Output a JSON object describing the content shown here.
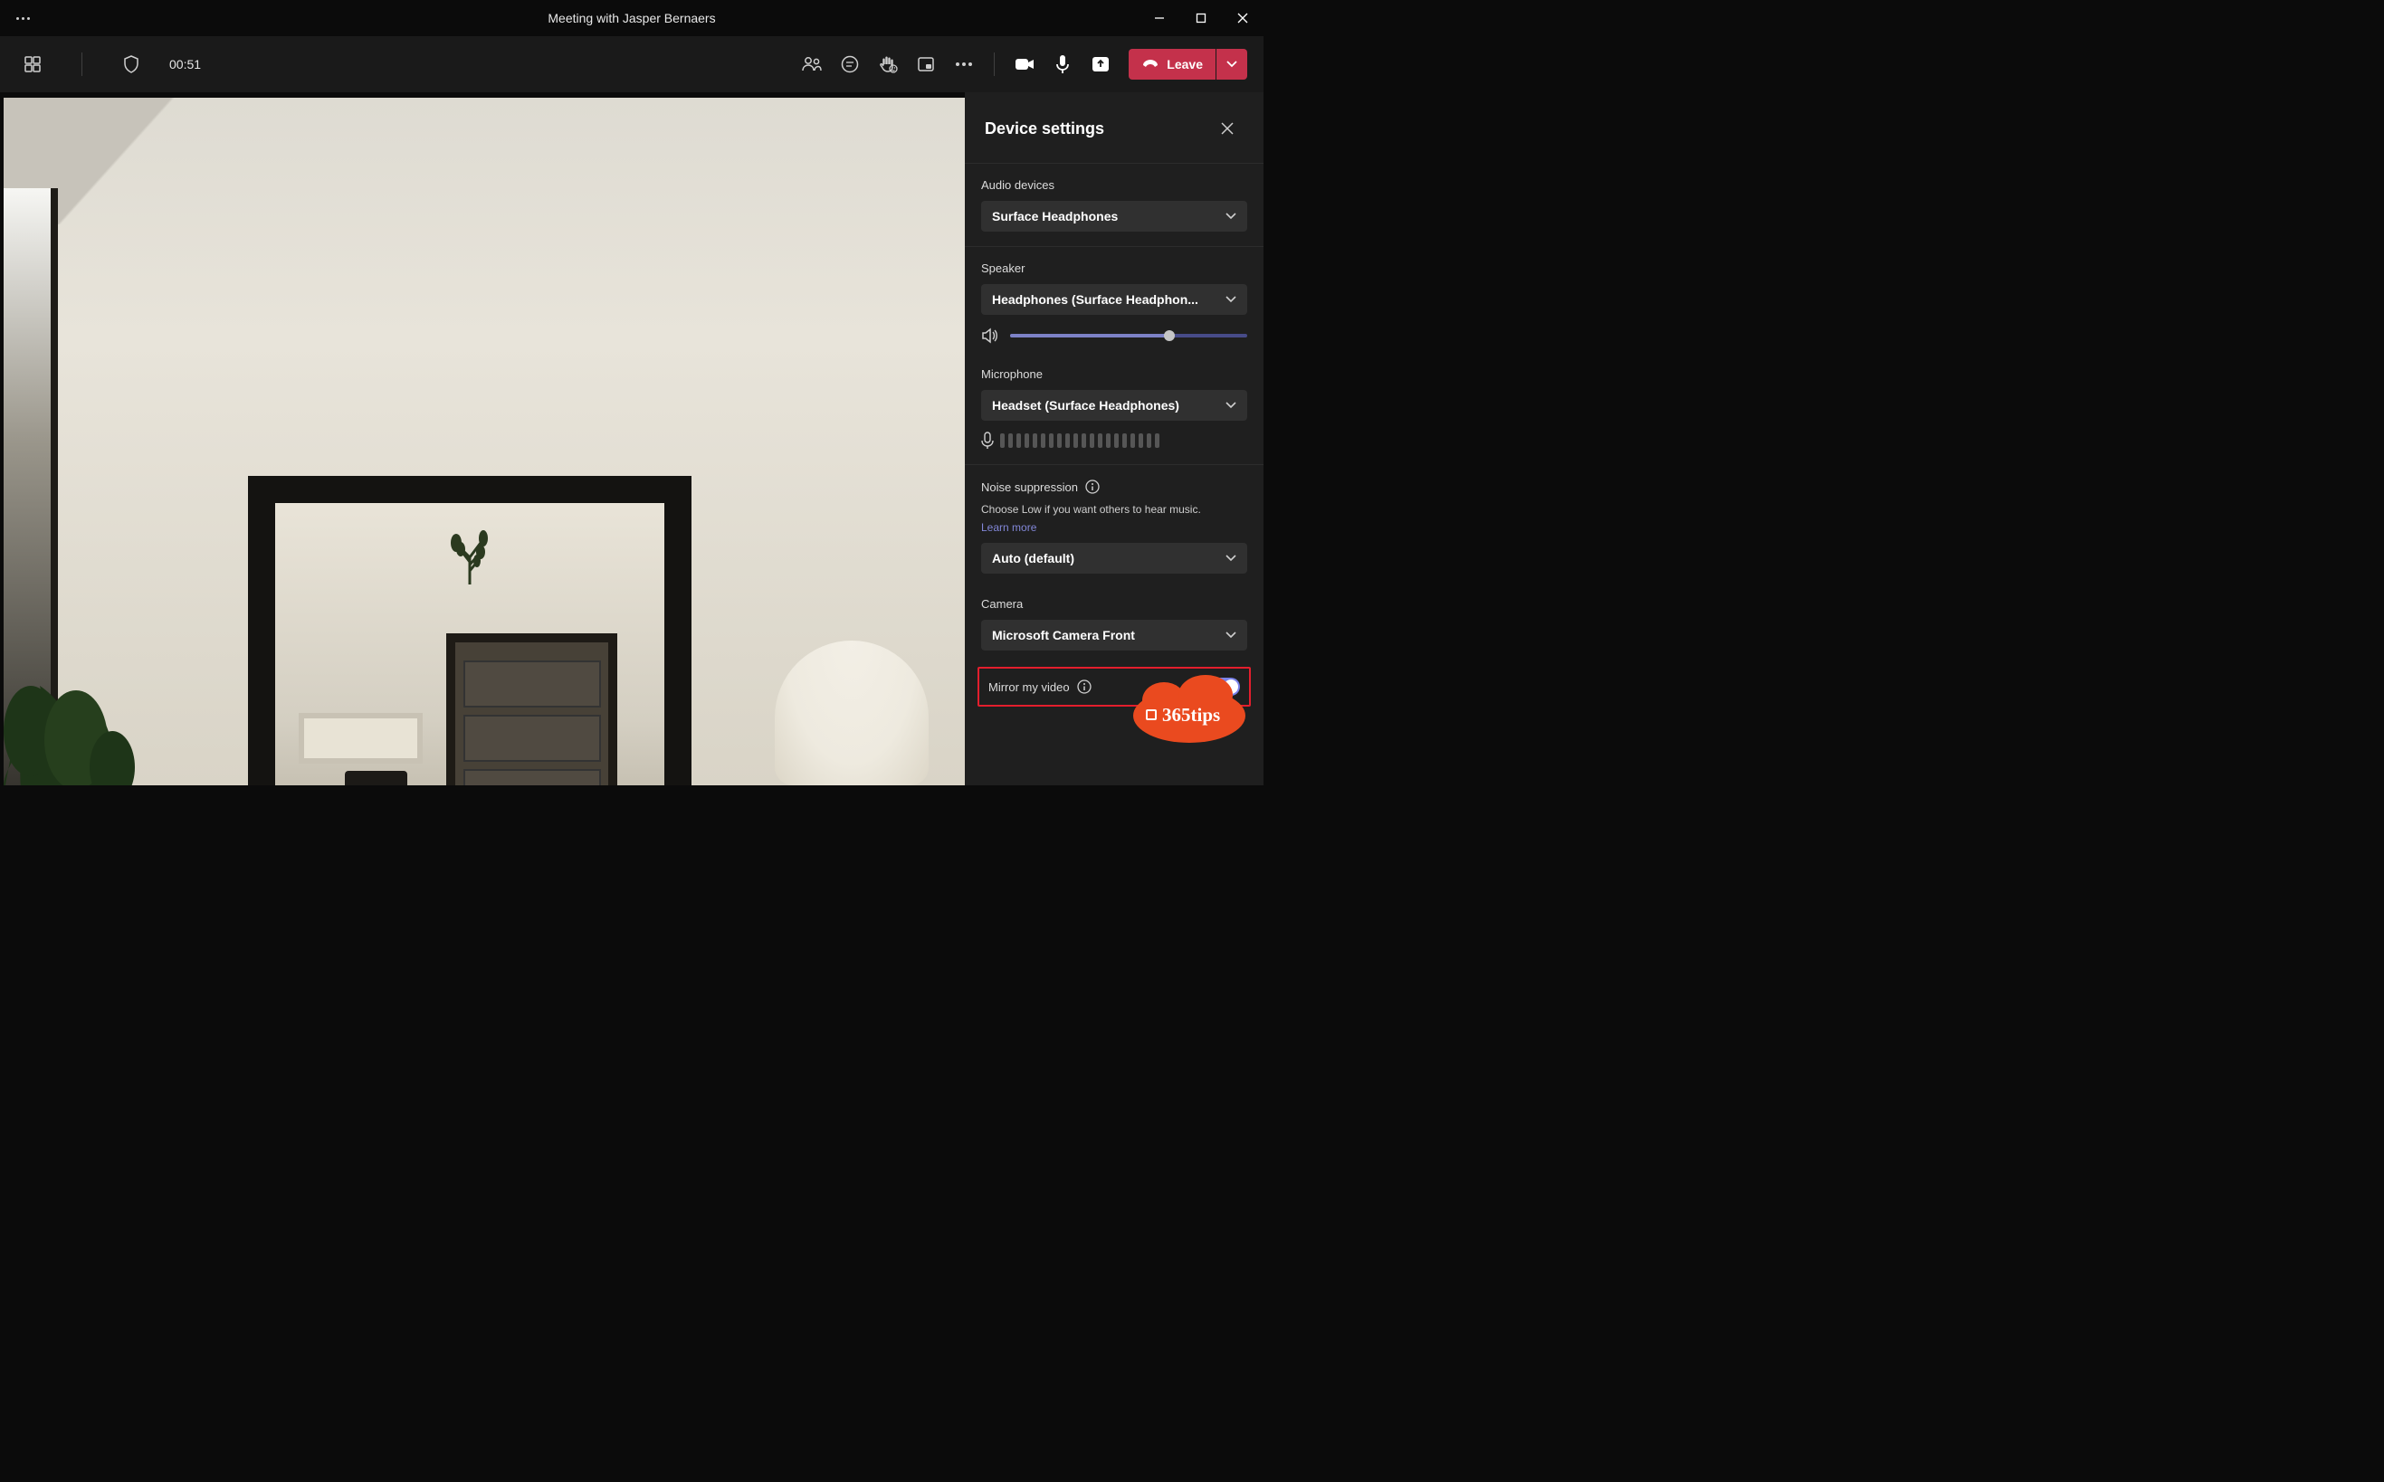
{
  "title": "Meeting with Jasper Bernaers",
  "toolbar": {
    "timer": "00:51",
    "leave_label": "Leave"
  },
  "panel": {
    "title": "Device settings",
    "audio_devices": {
      "label": "Audio devices",
      "value": "Surface Headphones"
    },
    "speaker": {
      "label": "Speaker",
      "value": "Headphones (Surface Headphon...",
      "volume_percent": 67
    },
    "microphone": {
      "label": "Microphone",
      "value": "Headset (Surface Headphones)"
    },
    "noise_suppression": {
      "label": "Noise suppression",
      "helper": "Choose Low if you want others to hear music.",
      "link": "Learn more",
      "value": "Auto (default)"
    },
    "camera": {
      "label": "Camera",
      "value": "Microsoft Camera Front"
    },
    "mirror": {
      "label": "Mirror my video",
      "enabled": true
    }
  },
  "logo_text": "365tips"
}
